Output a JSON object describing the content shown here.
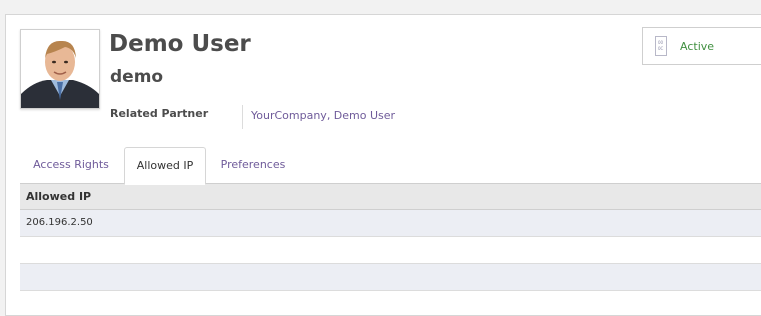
{
  "user": {
    "name": "Demo User",
    "login": "demo"
  },
  "fields": {
    "related_partner_label": "Related Partner",
    "related_partner_value": "YourCompany, Demo User"
  },
  "status": {
    "label": "Active",
    "icon": "archive-toggle-icon",
    "color": "#3f8f3f"
  },
  "tabs": [
    {
      "label": "Access Rights",
      "active": false
    },
    {
      "label": "Allowed IP",
      "active": true
    },
    {
      "label": "Preferences",
      "active": false
    }
  ],
  "grid": {
    "header": "Allowed IP",
    "rows": [
      "206.196.2.50",
      "",
      ""
    ]
  },
  "colors": {
    "link": "#6f5b9a",
    "row_alt": "#eceef4",
    "header_bg": "#e8e8e8"
  }
}
